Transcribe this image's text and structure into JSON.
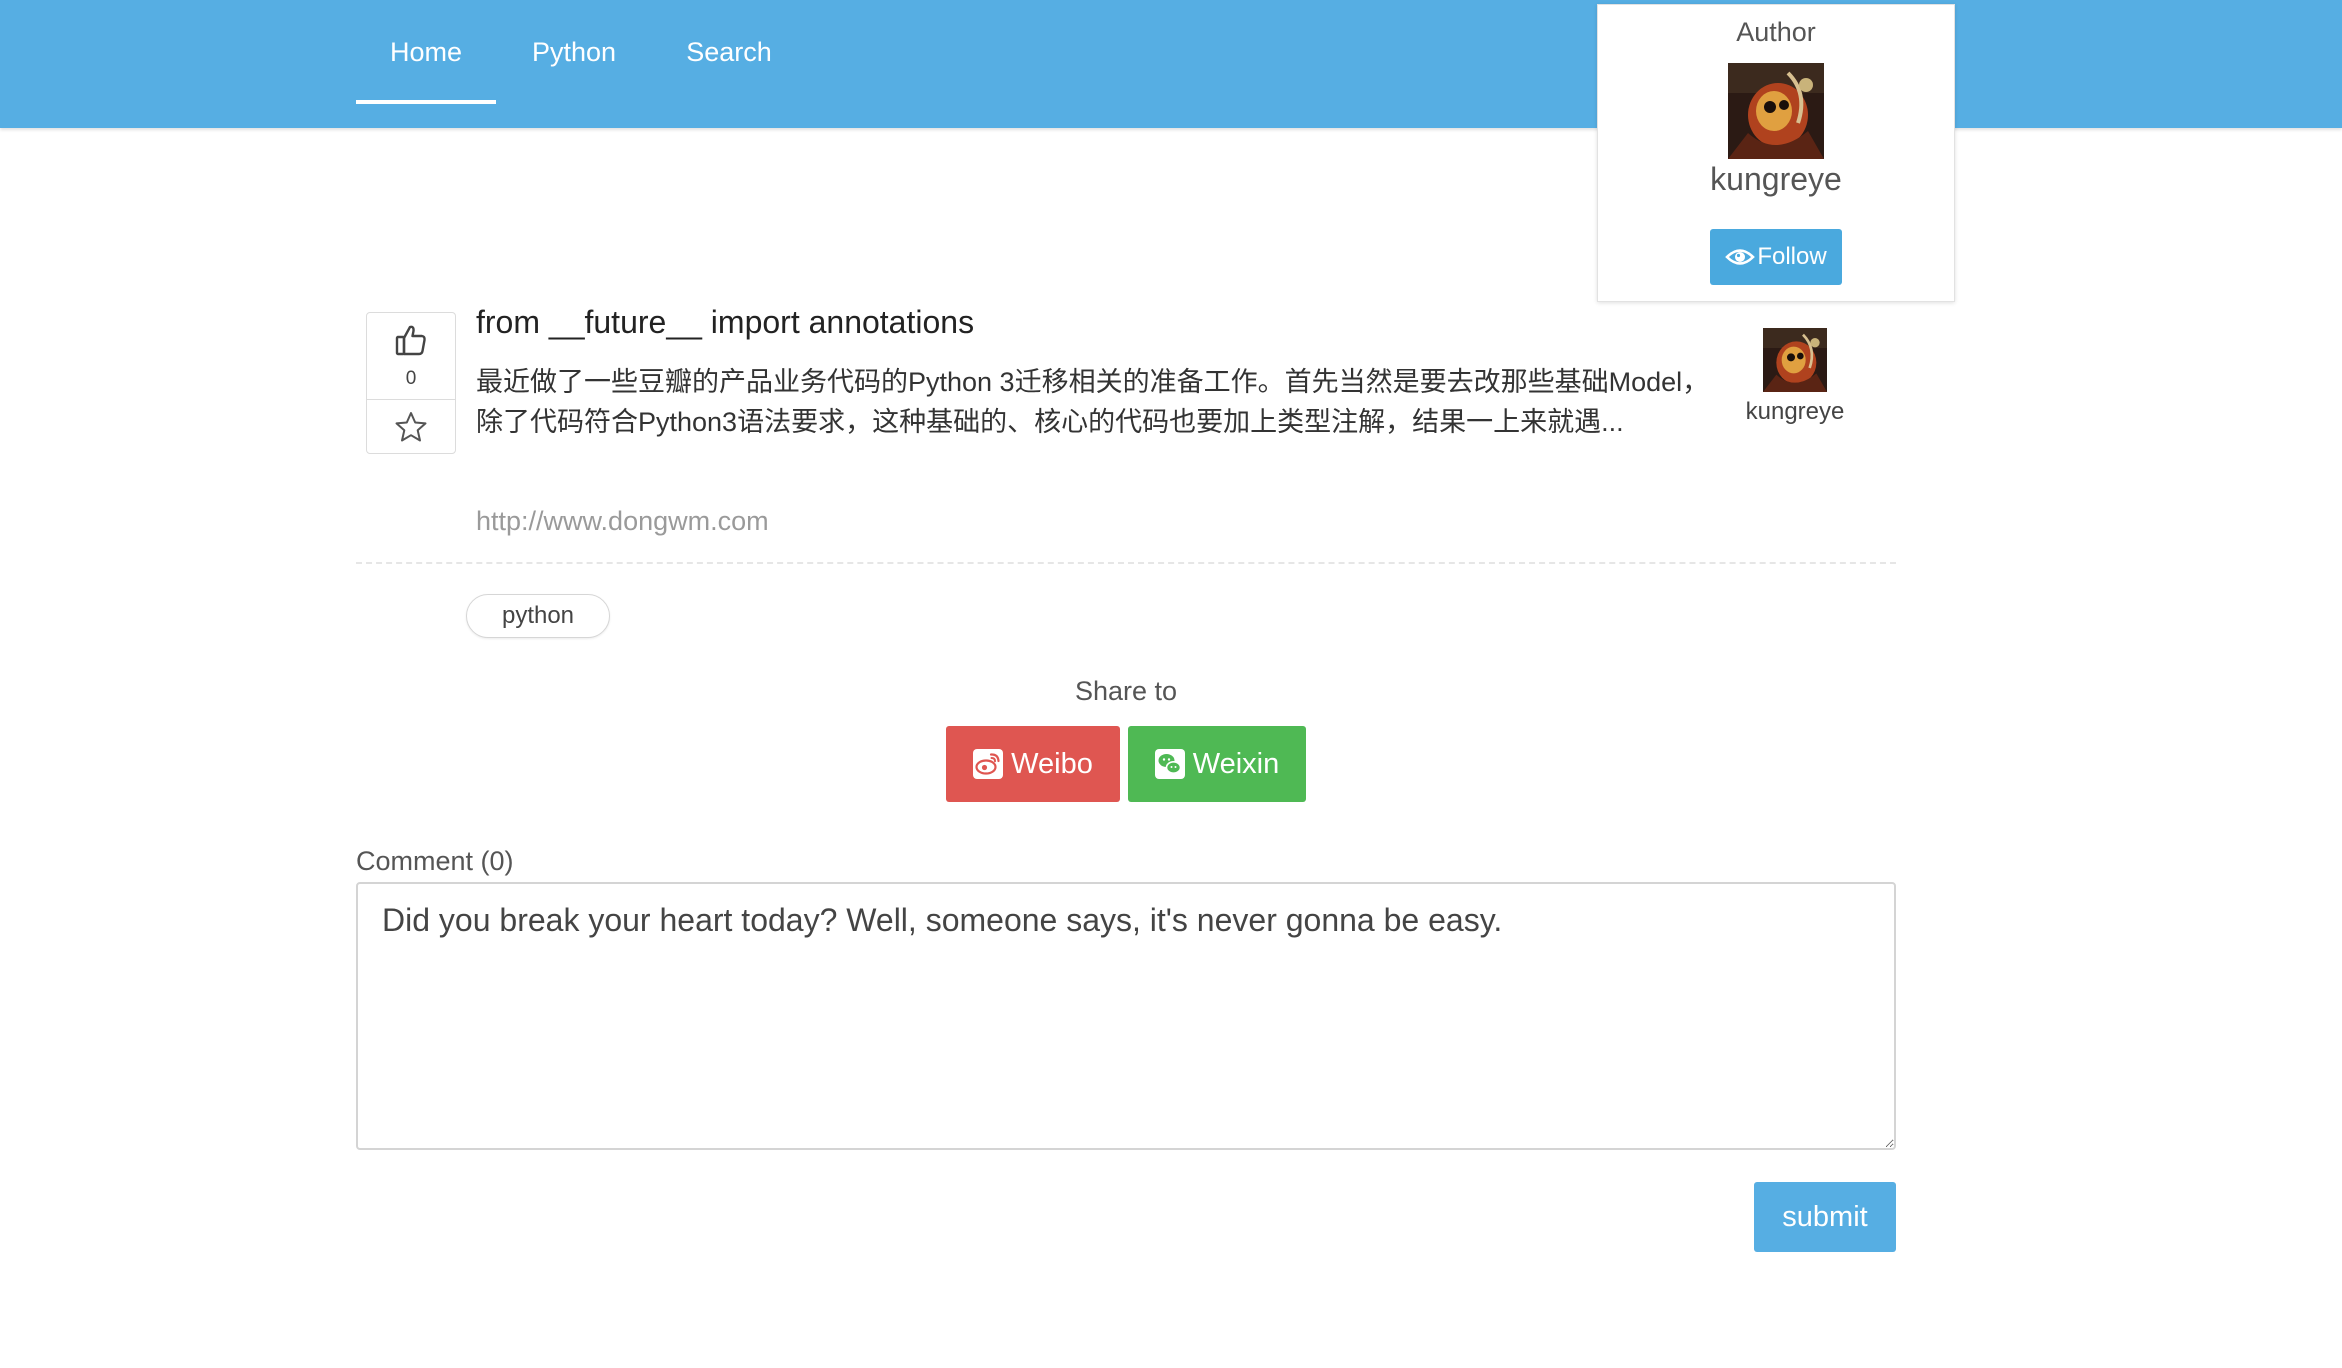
{
  "nav": {
    "items": [
      {
        "label": "Home",
        "active": true
      },
      {
        "label": "Python",
        "active": false
      },
      {
        "label": "Search",
        "active": false
      }
    ]
  },
  "author_card": {
    "title": "Author",
    "name": "kungreye",
    "follow_label": "Follow",
    "follow_icon": "eye-icon"
  },
  "post": {
    "like_count": "0",
    "like_icon": "thumbs-up-icon",
    "favorite_icon": "star-icon",
    "title": "from __future__ import annotations",
    "excerpt": "最近做了一些豆瓣的产品业务代码的Python 3迁移相关的准备工作。首先当然是要去改那些基础Model，除了代码符合Python3语法要求，这种基础的、核心的代码也要加上类型注解，结果一上来就遇...",
    "source_link": "http://www.dongwm.com",
    "author_name": "kungreye",
    "tags": [
      "python"
    ]
  },
  "share": {
    "title": "Share to",
    "weibo_label": "Weibo",
    "weibo_icon": "weibo-icon",
    "weixin_label": "Weixin",
    "weixin_icon": "wechat-icon"
  },
  "comment": {
    "label": "Comment (0)",
    "text": "Did you break your heart today? Well, someone says, it's never gonna be easy.",
    "submit_label": "submit"
  },
  "colors": {
    "navbar": "#56aee3",
    "follow_button": "#4aa9de",
    "weibo": "#df5651",
    "weixin": "#4fb954",
    "submit_button": "#56aee3"
  }
}
